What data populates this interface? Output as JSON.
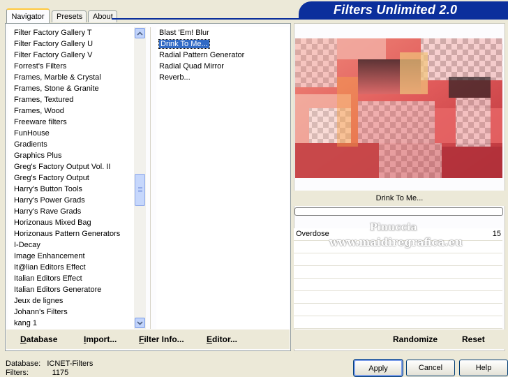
{
  "tabs": [
    "Navigator",
    "Presets",
    "About"
  ],
  "header_title": "Filters Unlimited 2.0",
  "categories": [
    "Filter Factory Gallery T",
    "Filter Factory Gallery U",
    "Filter Factory Gallery V",
    "Forrest's Filters",
    "Frames, Marble & Crystal",
    "Frames, Stone & Granite",
    "Frames, Textured",
    "Frames, Wood",
    "Freeware filters",
    "FunHouse",
    "Gradients",
    "Graphics Plus",
    "Greg's Factory Output Vol. II",
    "Greg's Factory Output",
    "Harry's Button Tools",
    "Harry's Power Grads",
    "Harry's Rave Grads",
    "Horizonaus Mixed Bag",
    "Horizonaus Pattern Generators",
    "I-Decay",
    "Image Enhancement",
    "It@lian Editors Effect",
    "Italian Editors Effect",
    "Italian Editors Generatore",
    "Jeux de lignes",
    "Johann's Filters",
    "kang 1"
  ],
  "filters": [
    "Blast 'Em! Blur",
    "Drink To Me...",
    "Radial Pattern Generator",
    "Radial Quad Mirror",
    "Reverb..."
  ],
  "selected_filter_index": 1,
  "selected_filter_name": "Drink To Me...",
  "left_footer": {
    "database": "Database",
    "import": "Import...",
    "filter_info": "Filter Info...",
    "editor": "Editor..."
  },
  "right_footer": {
    "randomize": "Randomize",
    "reset": "Reset"
  },
  "parameter": {
    "label": "Overdose",
    "value": "15"
  },
  "watermark": {
    "line1": "Pinuccia",
    "line2": "www.maidiregrafica.eu"
  },
  "status": {
    "database_label": "Database:",
    "database_value": "ICNET-Filters",
    "filters_label": "Filters:",
    "filters_value": "1175"
  },
  "buttons": {
    "apply": "Apply",
    "cancel": "Cancel",
    "help": "Help"
  },
  "colors": {
    "accent": "#0b2f9c",
    "selection": "#316ac5",
    "tab_highlight": "#ffc83c"
  }
}
